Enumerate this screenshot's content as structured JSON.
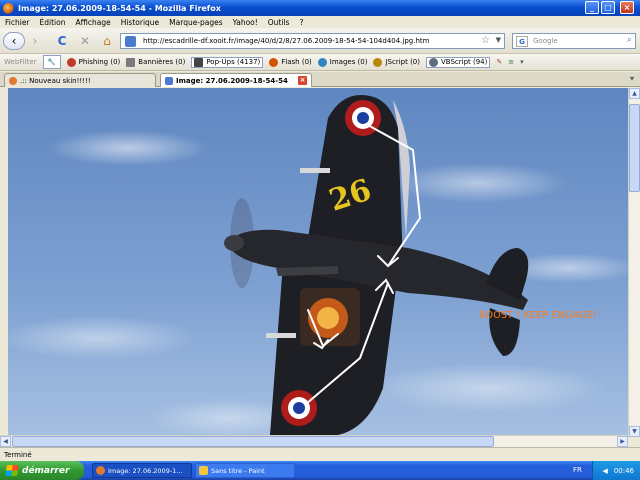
{
  "window": {
    "title": "Image: 27.06.2009-18-54-54 - Mozilla Firefox",
    "minimize": "_",
    "maximize": "□",
    "close": "×"
  },
  "menu": [
    "Fichier",
    "Édition",
    "Affichage",
    "Historique",
    "Marque-pages",
    "Yahoo!",
    "Outils",
    "?"
  ],
  "nav": {
    "url": "http://escadrille-df.xooit.fr/image/40/d/2/8/27.06.2009-18-54-54-104d404.jpg.htm",
    "search_placeholder": "Google",
    "star": "☆",
    "back": "‹",
    "forward": "›",
    "reload": "C",
    "stop": "✕",
    "home": "⌂"
  },
  "webfilter": {
    "label": "WebFilter",
    "items": [
      {
        "label": "Phishing (0)",
        "color": "#c0392b"
      },
      {
        "label": "Bannières (0)",
        "color": "#7a7a7a"
      },
      {
        "label": "Pop-Ups (4137)",
        "color": "#444444"
      },
      {
        "label": "Flash (0)",
        "color": "#d35400"
      },
      {
        "label": "Images (0)",
        "color": "#2e86c1"
      },
      {
        "label": "JScript (0)",
        "color": "#b8860b"
      },
      {
        "label": "VBScript (94)",
        "color": "#5d6d7e"
      }
    ]
  },
  "tabs": [
    {
      "label": ".:: Nouveau skin!!!!!",
      "active": false
    },
    {
      "label": "Image: 27.06.2009-18-54-54",
      "active": true
    }
  ],
  "content": {
    "overlay_text": "BOOST ! KEEP ENGAGE!",
    "tail_number": "26",
    "accent": "#ff7b18"
  },
  "status": "Terminé",
  "taskbar": {
    "start": "démarrer",
    "buttons": [
      {
        "label": "Image: 27.06.2009-1..."
      },
      {
        "label": "Sans titre - Paint"
      }
    ],
    "lang": "FR",
    "clock": "00:46"
  }
}
